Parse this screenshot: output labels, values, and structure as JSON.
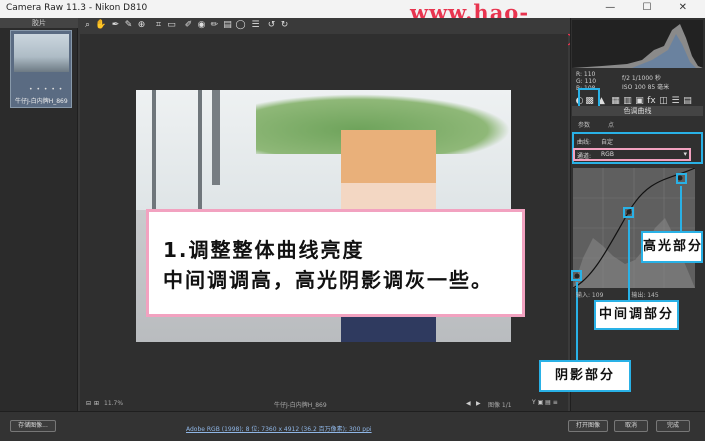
{
  "window": {
    "title": "Camera Raw 11.3 -  Nikon D810",
    "controls": "— ☐ ✕"
  },
  "watermark": "www.hao-vidiandhaji.com",
  "filmstrip": {
    "header": "胶片",
    "thumb_stars": "• • • • •",
    "thumb_name": "牛仔J-白内牌H_869"
  },
  "toolbar": {
    "icons": [
      "zoom-icon",
      "hand-icon",
      "white-balance-icon",
      "color-sampler-icon",
      "target-adjust-icon",
      "crop-icon",
      "straighten-icon",
      "spot-removal-icon",
      "red-eye-icon",
      "adjust-brush-icon",
      "graduated-filter-icon",
      "radial-filter-icon",
      "preferences-icon",
      "rotate-ccw-icon",
      "rotate-cw-icon"
    ]
  },
  "callout": {
    "line1": "1.调整整体曲线亮度",
    "line2": "中间调调高，高光阴影调灰一些。"
  },
  "histogram": {
    "r": "R: 110",
    "g": "G: 110",
    "b": "B: 108",
    "exposure": "f/2  1/1000 秒",
    "iso": "ISO 100  85 毫米"
  },
  "panel": {
    "subheader": "色调曲线",
    "tab1": "参数",
    "tab2": "点"
  },
  "curve": {
    "curve_label": "曲线:",
    "curve_value": "自定",
    "channel_label": "通道:",
    "channel_value": "RGB"
  },
  "inout": {
    "input": "输入: 109",
    "output": "输出: 145"
  },
  "labels": {
    "highlights": "高光部分",
    "midtones": "中间调部分",
    "shadows": "阴影部分"
  },
  "status": {
    "zoom": "11.7%",
    "filename": "牛仔J-白内牌H_869",
    "page": "图像 1/1"
  },
  "workflow": "Adobe RGB (1998); 8 位; 7360 x 4912 (36.2 百万像素); 300 ppi",
  "buttons": {
    "save": "存储图像...",
    "open": "打开图像",
    "cancel": "取消",
    "done": "完成"
  },
  "colors": {
    "highlight_blue": "#29b1e6",
    "highlight_pink": "#f2a2c0",
    "watermark_red": "#e8344f"
  }
}
